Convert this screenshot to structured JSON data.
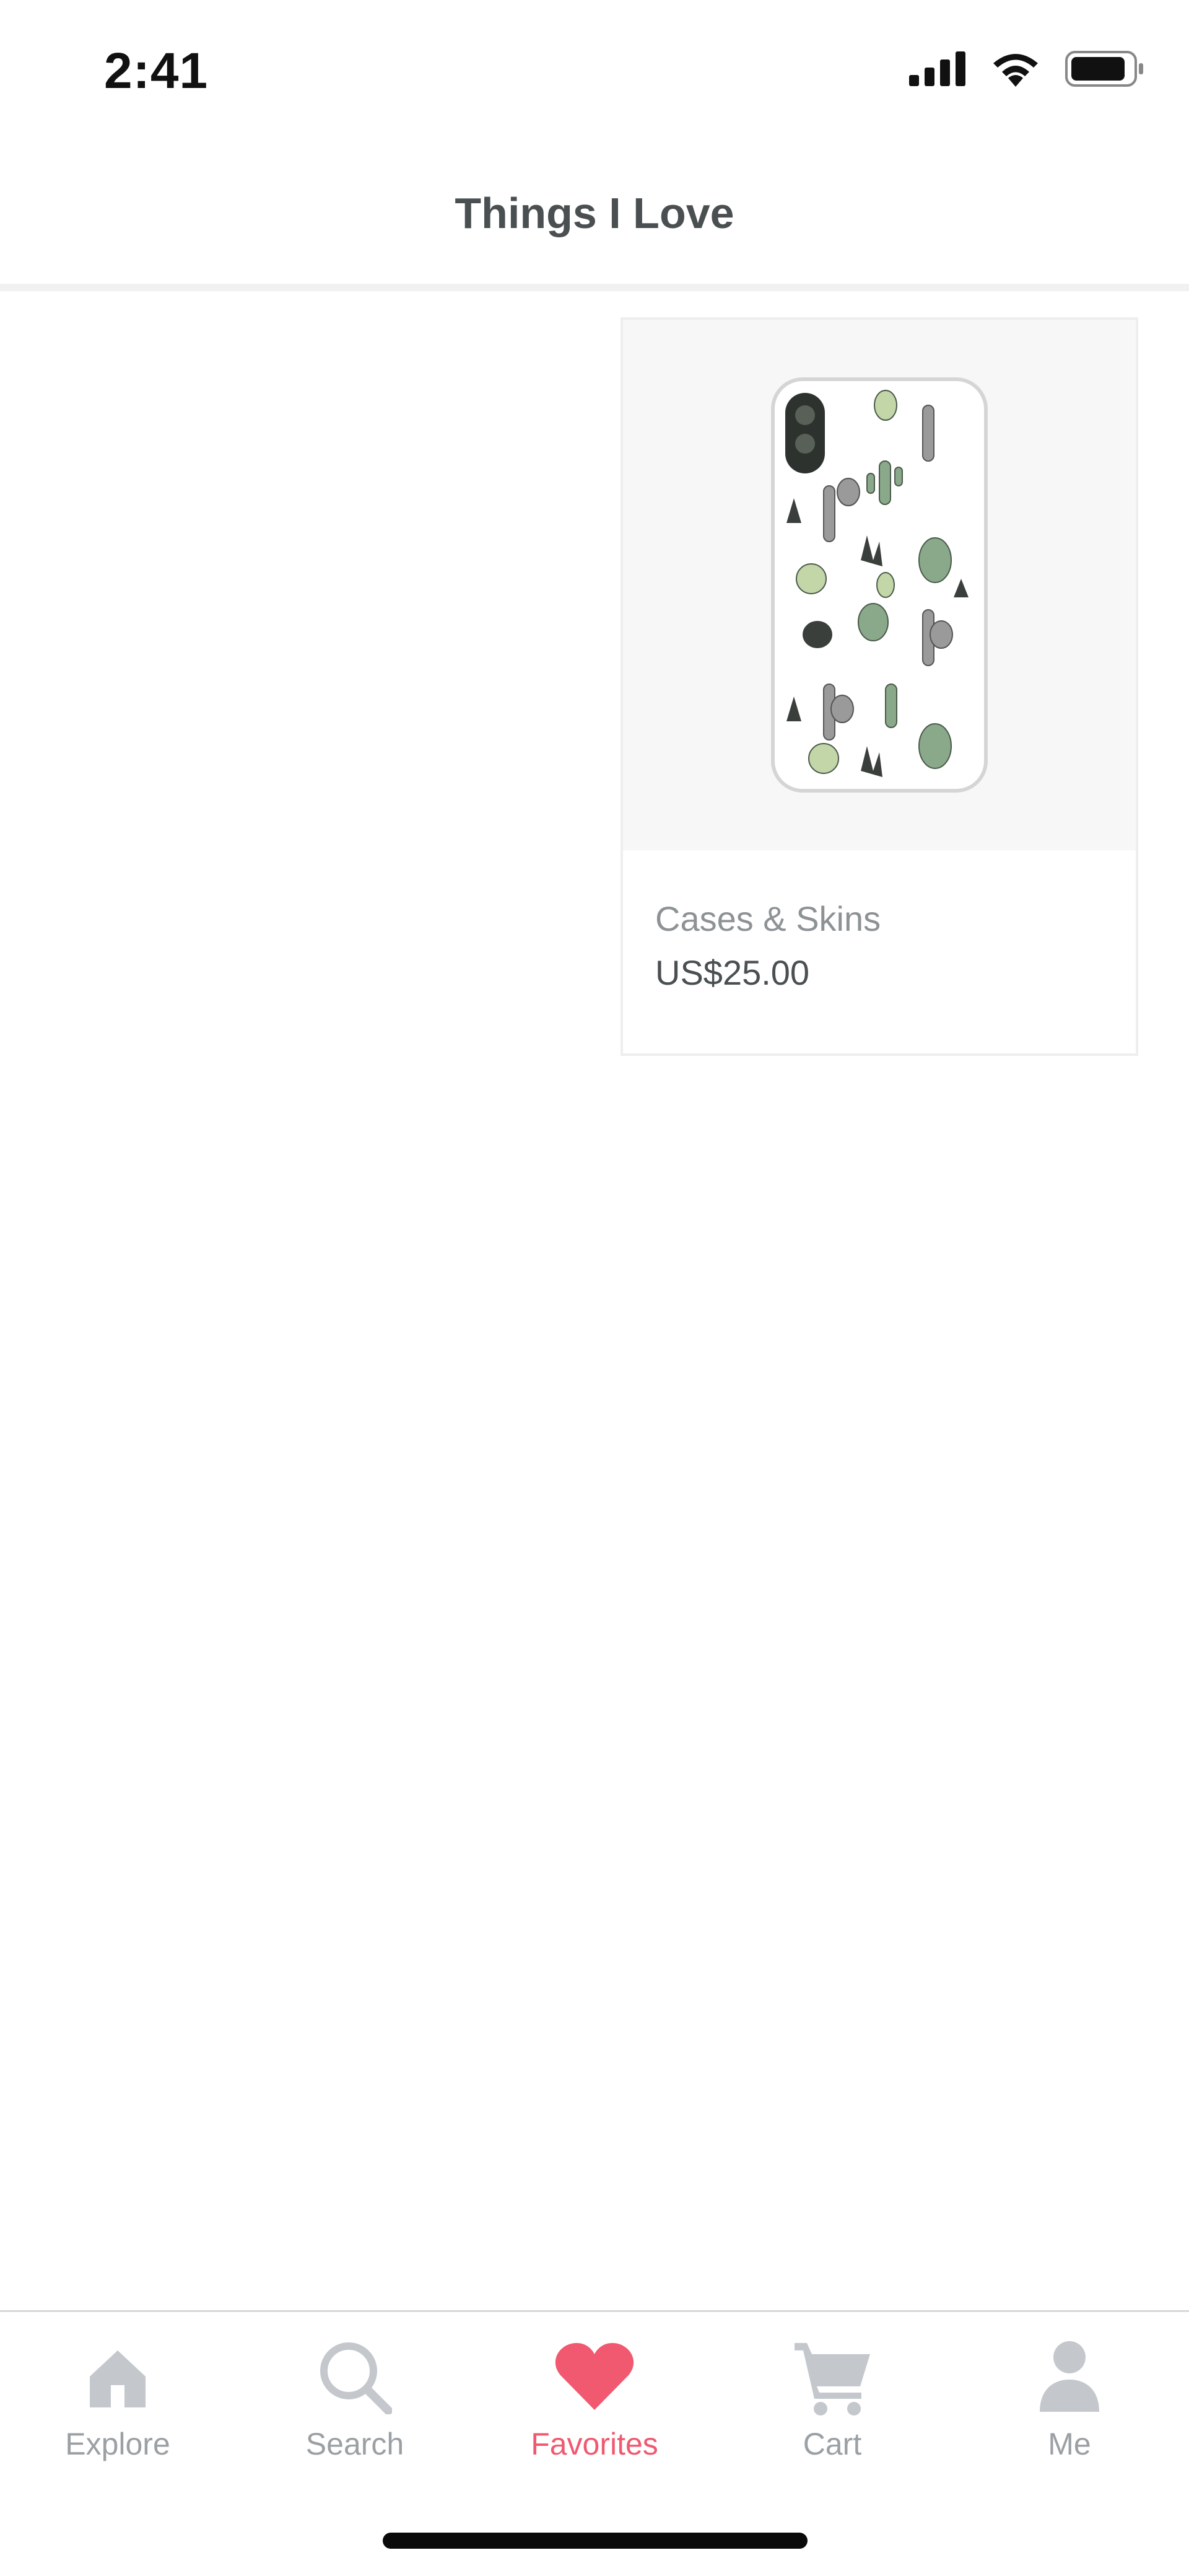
{
  "status_bar": {
    "time": "2:41",
    "icons": [
      "cellular-signal-icon",
      "wifi-icon",
      "battery-icon"
    ]
  },
  "header": {
    "title": "Things I Love"
  },
  "favorites": {
    "items": [
      {
        "category": "Cases & Skins",
        "price": "US$25.00",
        "image": "phone-case-cactus-pattern"
      }
    ]
  },
  "tab_bar": {
    "active": "favorites",
    "items": [
      {
        "id": "explore",
        "label": "Explore",
        "icon": "home-icon"
      },
      {
        "id": "search",
        "label": "Search",
        "icon": "search-icon"
      },
      {
        "id": "favorites",
        "label": "Favorites",
        "icon": "heart-icon"
      },
      {
        "id": "cart",
        "label": "Cart",
        "icon": "cart-icon"
      },
      {
        "id": "me",
        "label": "Me",
        "icon": "person-icon"
      }
    ]
  },
  "colors": {
    "accent": "#f05970",
    "tab_inactive": "#c4c8cc",
    "title_text": "#4a4f51",
    "muted_text": "#8d9295"
  }
}
